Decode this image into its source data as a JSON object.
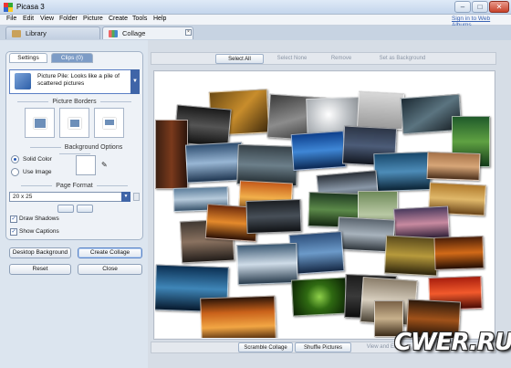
{
  "window": {
    "title": "Picasa 3",
    "minimize": "–",
    "maximize": "□",
    "close": "✕"
  },
  "menu": [
    "File",
    "Edit",
    "View",
    "Folder",
    "Picture",
    "Create",
    "Tools",
    "Help"
  ],
  "signin": "Sign in to Web Albums",
  "tabs": {
    "library": "Library",
    "collage": "Collage",
    "close": "×"
  },
  "panel": {
    "tab_settings": "Settings",
    "tab_clips": "Clips (0)",
    "style_text": "Picture Pile:  Looks like a pile of scattered pictures",
    "picture_borders": "Picture Borders",
    "background_options": "Background Options",
    "solid_color": "Solid Color",
    "use_image": "Use Image",
    "page_format": "Page Format",
    "format_value": "20 x 25",
    "draw_shadows": "Draw Shadows",
    "show_captions": "Show Captions"
  },
  "buttons": {
    "desktop_background": "Desktop Background",
    "create_collage": "Create Collage",
    "reset": "Reset",
    "close": "Close"
  },
  "toolbar": {
    "select_all": "Select All",
    "select_none": "Select None",
    "remove": "Remove",
    "set_background": "Set as Background"
  },
  "bottom": {
    "scramble": "Scramble Collage",
    "shuffle": "Shuffle Pictures",
    "view_edit": "View and Edit"
  },
  "watermark": "CWER.RU",
  "colors": {
    "accent": "#3f65a8",
    "tab_clips": "#7d9cc6",
    "titlebar": "#c3d5ec",
    "link": "#3a63b4"
  }
}
